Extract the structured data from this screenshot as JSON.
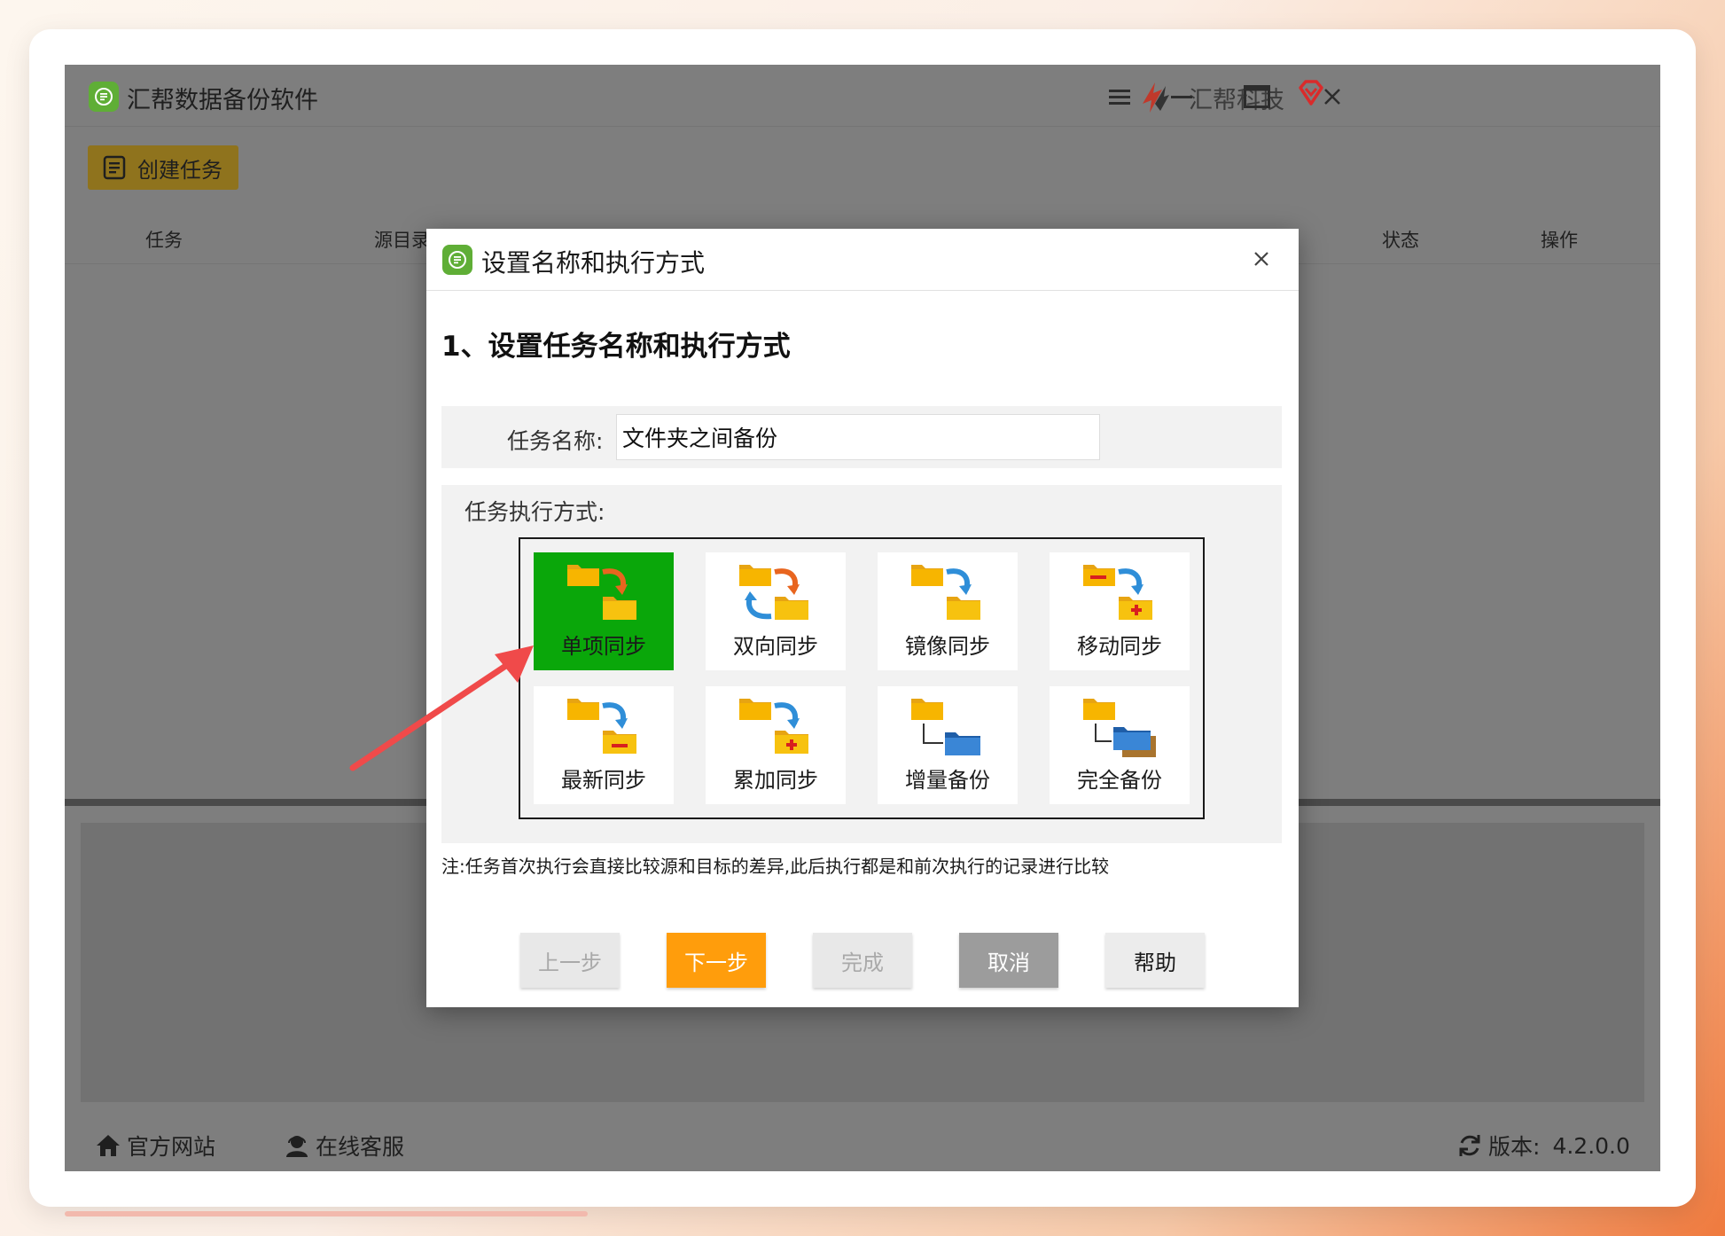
{
  "app": {
    "title": "汇帮数据备份软件",
    "brand": "汇帮科技",
    "create_task_label": "创建任务",
    "columns": [
      "任务",
      "源目录",
      "状态",
      "操作"
    ],
    "status_bar": {
      "website": "官方网站",
      "support": "在线客服",
      "version_label": "版本:",
      "version_value": "4.2.0.0"
    }
  },
  "dialog": {
    "title": "设置名称和执行方式",
    "step_heading": "1、设置任务名称和执行方式",
    "task_name_label": "任务名称:",
    "task_name_value": "文件夹之间备份",
    "mode_label": "任务执行方式:",
    "modes": [
      {
        "label": "单项同步",
        "icon": "one-way-sync-icon",
        "selected": true
      },
      {
        "label": "双向同步",
        "icon": "two-way-sync-icon",
        "selected": false
      },
      {
        "label": "镜像同步",
        "icon": "mirror-sync-icon",
        "selected": false
      },
      {
        "label": "移动同步",
        "icon": "move-sync-icon",
        "selected": false
      },
      {
        "label": "最新同步",
        "icon": "latest-sync-icon",
        "selected": false
      },
      {
        "label": "累加同步",
        "icon": "cumulative-sync-icon",
        "selected": false
      },
      {
        "label": "增量备份",
        "icon": "incremental-backup-icon",
        "selected": false
      },
      {
        "label": "完全备份",
        "icon": "full-backup-icon",
        "selected": false
      }
    ],
    "note": "注:任务首次执行会直接比较源和目标的差异,此后执行都是和前次执行的记录进行比较",
    "buttons": {
      "prev": "上一步",
      "next": "下一步",
      "finish": "完成",
      "cancel": "取消",
      "help": "帮助"
    }
  },
  "colors": {
    "selected_tile": "#0aa70a",
    "next_button": "#ff9d0c",
    "toolbar_button": "#8f731d",
    "annotation_arrow": "#f04a4a"
  }
}
